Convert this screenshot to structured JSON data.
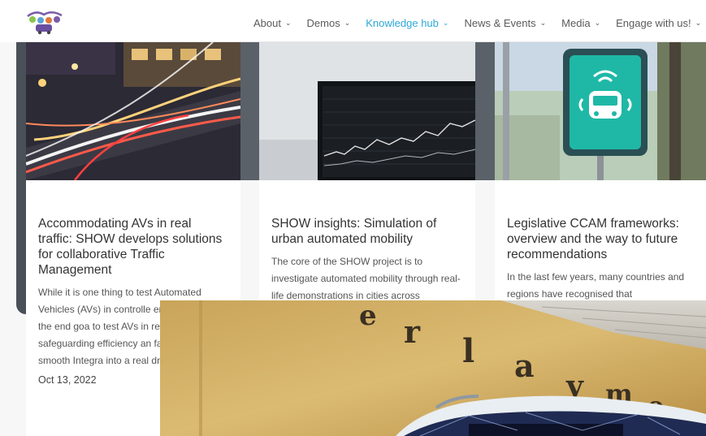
{
  "nav": {
    "items": [
      {
        "label": "About",
        "active": false
      },
      {
        "label": "Demos",
        "active": false
      },
      {
        "label": "Knowledge hub",
        "active": true
      },
      {
        "label": "News & Events",
        "active": false
      },
      {
        "label": "Media",
        "active": false
      },
      {
        "label": "Engage with us!",
        "active": false
      }
    ],
    "accent_color": "#2da8d8",
    "chevron_icon": "chevron-down-icon"
  },
  "cards": [
    {
      "title": "Accommodating AVs in real traffic: SHOW develops solutions for collaborative Traffic Management",
      "excerpt": "While it is one thing to test Automated Vehicles (AVs) in controlle environments, the end goa to test AVs in real life whil safeguarding efficiency an facilitate a smooth Integra into a real driving environ",
      "date": "Oct 13, 2022"
    },
    {
      "title": "SHOW insights: Simulation of urban automated mobility",
      "excerpt": "The core of the SHOW project is to investigate automated mobility through real-life demonstrations in cities across"
    },
    {
      "title": "Legislative CCAM frameworks: overview and the way to future recommendations",
      "excerpt": "In the last few years, many countries and regions have recognised that"
    }
  ],
  "overlay": {
    "sign_letters": "e r l a y m o n t"
  }
}
